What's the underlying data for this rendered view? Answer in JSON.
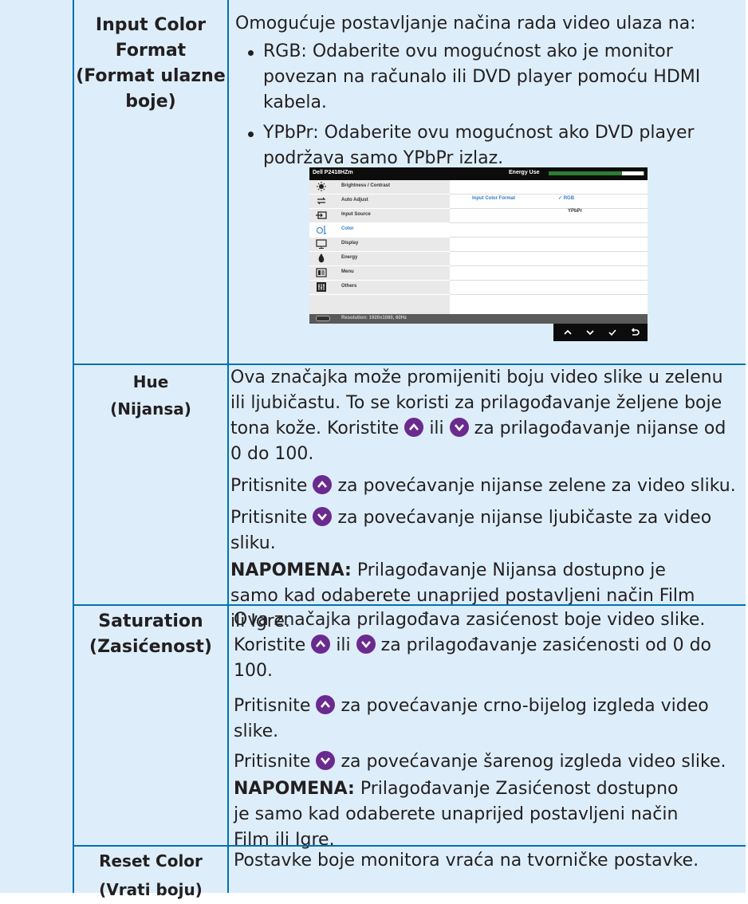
{
  "rows": {
    "input_color_format": {
      "name_lines": [
        "Input Color",
        "Format",
        "(Format ulazne",
        "boje)"
      ],
      "intro": "Omogućuje postavljanje načina rada video ulaza na:",
      "bullets": [
        "RGB: Odaberite ovu mogućnost ako je monitor povezan na računalo ili DVD player pomoću HDMI kabela.",
        "YPbPr: Odaberite ovu mogućnost ako DVD player podržava samo YPbPr izlaz."
      ]
    },
    "hue": {
      "name_lines": [
        "Hue",
        "(Nijansa)"
      ],
      "p1_a": "Ova značajka može promijeniti boju video slike u zelenu ili ljubičastu. To se koristi za prilagođavanje željene boje tona kože. Koristite",
      "p1_b": "ili",
      "p1_c": "za prilagođavanje nijanse od 0 do 100.",
      "p2_a": "Pritisnite",
      "p2_b": "za povećavanje nijanse zelene za video sliku.",
      "p3_a": "Pritisnite",
      "p3_b": "za povećavanje nijanse ljubičaste za video sliku.",
      "note_label": "NAPOMENA:",
      "note_text": "Prilagođavanje Nijansa dostupno je samo kad odaberete unaprijed postavljeni način Film ili Igre."
    },
    "saturation": {
      "name_lines": [
        "Saturation",
        "(Zasićenost)"
      ],
      "p1_a": "Ova značajka prilagođava zasićenost boje video slike. Koristite",
      "p1_b": "ili",
      "p1_c": "za prilagođavanje zasićenosti od 0 do 100.",
      "p2_a": "Pritisnite",
      "p2_b": "za povećavanje crno-bijelog izgleda video slike.",
      "p3_a": "Pritisnite",
      "p3_b": "za povećavanje šarenog izgleda video slike.",
      "note_label": "NAPOMENA:",
      "note_text": "Prilagođavanje Zasićenost dostupno je samo kad odaberete unaprijed postavljeni način Film ili Igre."
    },
    "reset_color": {
      "name_lines": [
        "Reset Color",
        "(Vrati boju)"
      ],
      "desc": "Postavke boje monitora vraća na tvorničke postavke."
    }
  },
  "osd": {
    "model": "Dell P2418HZm",
    "energy_label": "Energy Use",
    "menu_items": [
      {
        "label": "Brightness / Contrast",
        "icon": "brightness-icon"
      },
      {
        "label": "Auto Adjust",
        "icon": "auto-adjust-icon"
      },
      {
        "label": "Input Source",
        "icon": "input-source-icon"
      },
      {
        "label": "Color",
        "icon": "color-icon"
      },
      {
        "label": "Display",
        "icon": "display-icon"
      },
      {
        "label": "Energy",
        "icon": "energy-icon"
      },
      {
        "label": "Menu",
        "icon": "menu-icon"
      },
      {
        "label": "Others",
        "icon": "others-icon"
      }
    ],
    "selected_item": "Color",
    "option_label": "Input Color Format",
    "options": [
      "RGB",
      "YPbPr"
    ],
    "selected_option": "RGB",
    "resolution": "Resolution: 1920x1080, 60Hz",
    "nav_buttons": [
      "up-icon",
      "down-icon",
      "check-icon",
      "back-icon"
    ]
  },
  "colors": {
    "border": "#0072b2",
    "background": "#ddeefa",
    "button": "#6a2a8e",
    "osd_highlight": "#2f7ec5"
  }
}
